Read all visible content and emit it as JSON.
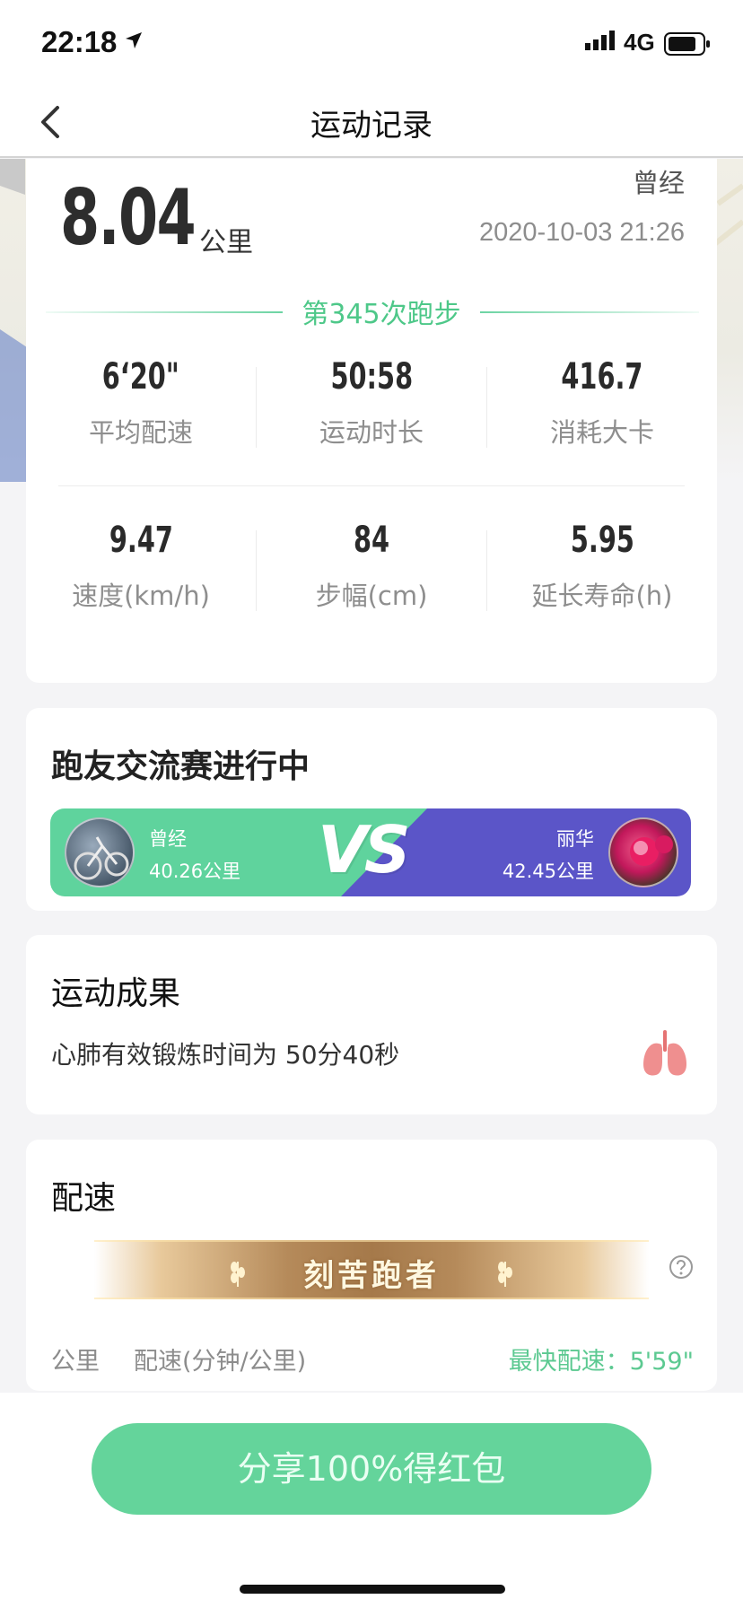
{
  "status_bar": {
    "time": "22:18",
    "network": "4G",
    "icons": [
      "location-arrow-icon",
      "signal-icon",
      "battery-icon"
    ]
  },
  "nav": {
    "title": "运动记录",
    "back_icon": "chevron-left-icon"
  },
  "summary": {
    "distance": "8.04",
    "distance_unit": "公里",
    "user_name": "曾经",
    "date_time": "2020-10-03 21:26",
    "run_count_label": "第345次跑步"
  },
  "stats": [
    {
      "value": "6‘20\"",
      "label": "平均配速"
    },
    {
      "value": "50:58",
      "label": "运动时长"
    },
    {
      "value": "416.7",
      "label": "消耗大卡"
    },
    {
      "value": "9.47",
      "label": "速度(km/h)"
    },
    {
      "value": "84",
      "label": "步幅(cm)"
    },
    {
      "value": "5.95",
      "label": "延长寿命(h)"
    }
  ],
  "race": {
    "title": "跑友交流赛进行中",
    "vs_label": "VS",
    "left": {
      "name": "曾经",
      "distance": "40.26公里"
    },
    "right": {
      "name": "丽华",
      "distance": "42.45公里"
    },
    "colors": {
      "left": "#5fd39d",
      "right": "#5b55c8"
    }
  },
  "result": {
    "title": "运动成果",
    "text": "心肺有效锻炼时间为 50分40秒",
    "icon": "lungs-icon"
  },
  "pace": {
    "title": "配速",
    "badge": "刻苦跑者",
    "col_km": "公里",
    "col_pace": "配速(分钟/公里)",
    "fastest": "最快配速：5'59\""
  },
  "share_button": "分享100%得红包",
  "colors": {
    "accent": "#5cc991",
    "share_bg": "#64d49b"
  }
}
